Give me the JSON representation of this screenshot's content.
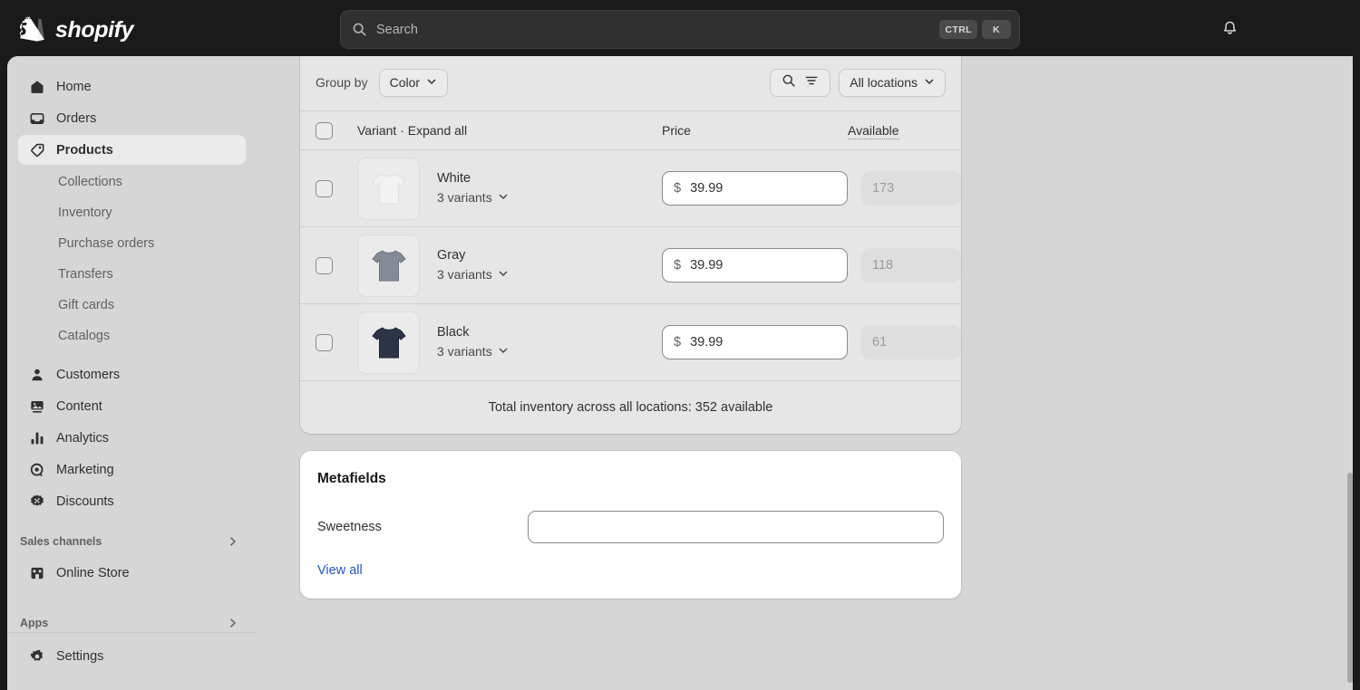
{
  "topbar": {
    "brand_name": "shopify",
    "brand_icon": "shopify-bag-icon",
    "search": {
      "placeholder": "Search",
      "value": "",
      "icon": "search-icon",
      "shortcut_modifier": "CTRL",
      "shortcut_key": "K"
    },
    "notifications_icon": "bell-icon",
    "background_color": "#1a1a1a"
  },
  "sidebar": {
    "background_color": "#d6d6d6",
    "items": [
      {
        "label": "Home",
        "icon": "home-icon",
        "active": false
      },
      {
        "label": "Orders",
        "icon": "orders-inbox-icon",
        "active": false
      },
      {
        "label": "Products",
        "icon": "product-tag-icon",
        "active": true
      }
    ],
    "product_subitems": [
      {
        "label": "Collections"
      },
      {
        "label": "Inventory"
      },
      {
        "label": "Purchase orders"
      },
      {
        "label": "Transfers"
      },
      {
        "label": "Gift cards"
      },
      {
        "label": "Catalogs"
      }
    ],
    "items_lower": [
      {
        "label": "Customers",
        "icon": "person-icon"
      },
      {
        "label": "Content",
        "icon": "content-image-icon"
      },
      {
        "label": "Analytics",
        "icon": "bar-chart-icon"
      },
      {
        "label": "Marketing",
        "icon": "marketing-target-icon"
      },
      {
        "label": "Discounts",
        "icon": "discount-badge-icon"
      }
    ],
    "sales_channels": {
      "label": "Sales channels",
      "expand_icon": "chevron-right-icon",
      "items": [
        {
          "label": "Online Store",
          "icon": "storefront-icon"
        }
      ]
    },
    "apps": {
      "label": "Apps",
      "expand_icon": "chevron-right-icon"
    },
    "settings": {
      "label": "Settings",
      "icon": "gear-icon"
    }
  },
  "variants_card": {
    "toolbar": {
      "group_by_label": "Group by",
      "group_by_value": "Color",
      "group_by_chevron": "chevron-down-icon",
      "search_icon": "search-icon",
      "filter_icon": "filter-icon",
      "location_value": "All locations",
      "location_chevron": "chevron-down-icon"
    },
    "columns": {
      "variant": "Variant · Expand all",
      "price": "Price",
      "available": "Available"
    },
    "rows": [
      {
        "name": "White",
        "variant_count": "3 variants",
        "chevron": "chevron-down-icon",
        "currency_symbol": "$",
        "price": "39.99",
        "available": "173",
        "swatch_color": "#f2f2f2",
        "swatch_stroke": "#e0e0e0"
      },
      {
        "name": "Gray",
        "variant_count": "3 variants",
        "chevron": "chevron-down-icon",
        "currency_symbol": "$",
        "price": "39.99",
        "available": "118",
        "swatch_color": "#858b96",
        "swatch_stroke": "#6d7480"
      },
      {
        "name": "Black",
        "variant_count": "3 variants",
        "chevron": "chevron-down-icon",
        "currency_symbol": "$",
        "price": "39.99",
        "available": "61",
        "swatch_color": "#2b3547",
        "swatch_stroke": "#1e2533"
      }
    ],
    "total_inventory": "Total inventory across all locations: 352 available"
  },
  "metafields_card": {
    "title": "Metafields",
    "fields": [
      {
        "label": "Sweetness",
        "value": "",
        "placeholder": ""
      }
    ],
    "view_all_label": "View all",
    "link_color": "#1f57c3"
  }
}
